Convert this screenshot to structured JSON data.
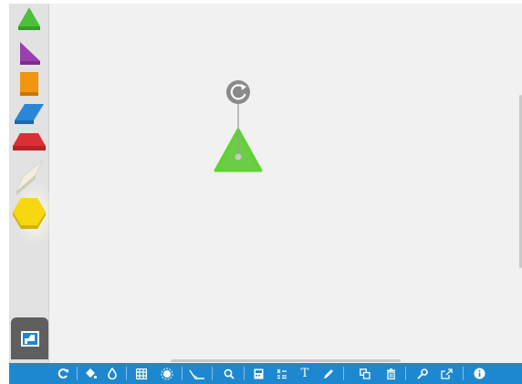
{
  "palette": {
    "shapes": [
      {
        "name": "triangle",
        "color": "#4cc03a"
      },
      {
        "name": "right-triangle",
        "color": "#9b3fb0"
      },
      {
        "name": "square",
        "color": "#f0960f"
      },
      {
        "name": "blue-parallelogram",
        "color": "#2a86d6"
      },
      {
        "name": "trapezoid",
        "color": "#dc2f35"
      },
      {
        "name": "thin-rhombus",
        "color": "#f2efe0"
      },
      {
        "name": "hexagon",
        "color": "#f7d711"
      }
    ],
    "import_icon": "import-shape-icon"
  },
  "canvas": {
    "selected_shape": "triangle",
    "selected_color": "#6ccc46",
    "rotate_icon": "rotate-icon"
  },
  "toolbar": {
    "accent_color": "#1d88cf",
    "icons": [
      "reset-icon",
      "fill-icon",
      "color-drop-icon",
      "grid-icon",
      "snap-icon",
      "protractor-icon",
      "zoom-icon",
      "calculator-icon",
      "equation-icon",
      "text-icon",
      "pencil-icon",
      "duplicate-icon",
      "trash-icon",
      "settings-icon",
      "share-icon",
      "info-icon"
    ],
    "text_tool_label": "T"
  }
}
